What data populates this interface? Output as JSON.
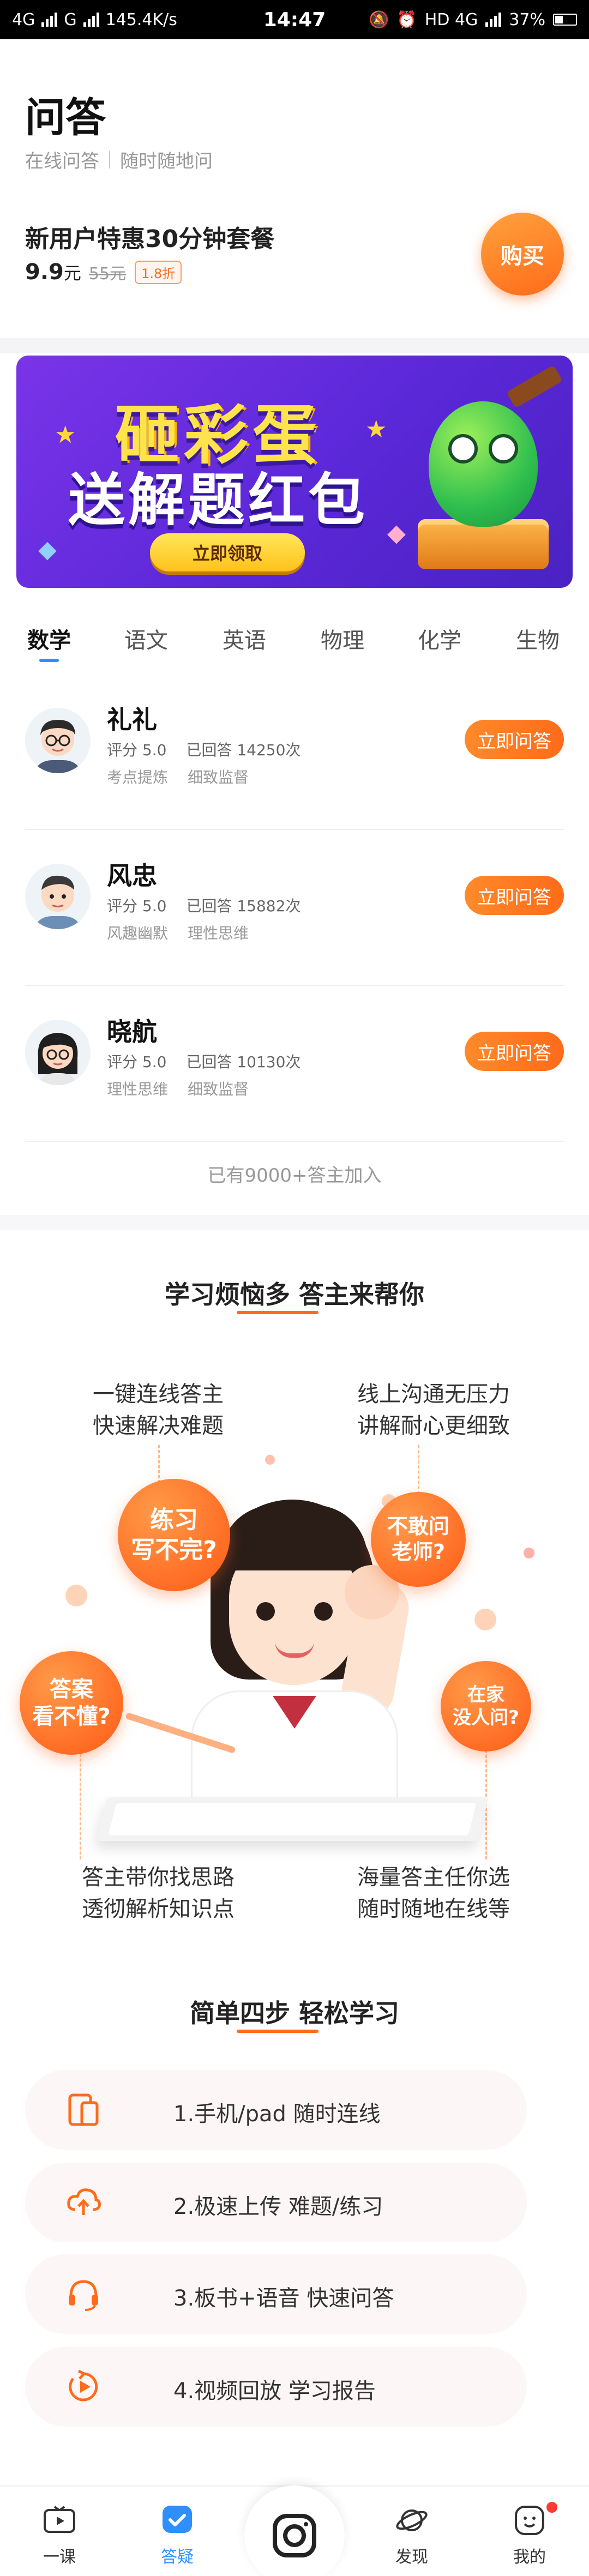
{
  "status_bar": {
    "network_left": "4G",
    "network_mid": "G",
    "speed": "145.4K/s",
    "time": "14:47",
    "network_right": "HD 4G",
    "battery": "37%"
  },
  "header": {
    "title": "问答",
    "subtitle_parts": [
      "在线问答",
      "随时随地问"
    ],
    "promo_title": "新用户特惠30分钟套餐",
    "price": "9.9",
    "price_unit": "元",
    "old_price": "55元",
    "discount": "1.8折",
    "buy_label": "购买"
  },
  "banner": {
    "line1": "砸彩蛋",
    "line2": "送解题红包",
    "button": "立即领取"
  },
  "tabs": [
    "数学",
    "语文",
    "英语",
    "物理",
    "化学",
    "生物"
  ],
  "active_tab": 0,
  "tutors": [
    {
      "name": "礼礼",
      "rating": "评分 5.0",
      "answered": "已回答 14250次",
      "tags": [
        "考点提炼",
        "细致监督"
      ],
      "ask_label": "立即问答",
      "avatar": "male-glasses-avatar"
    },
    {
      "name": "风忠",
      "rating": "评分 5.0",
      "answered": "已回答 15882次",
      "tags": [
        "风趣幽默",
        "理性思维"
      ],
      "ask_label": "立即问答",
      "avatar": "male-avatar"
    },
    {
      "name": "晓航",
      "rating": "评分 5.0",
      "answered": "已回答 10130次",
      "tags": [
        "理性思维",
        "细致监督"
      ],
      "ask_label": "立即问答",
      "avatar": "female-glasses-avatar"
    }
  ],
  "joined_text": "已有9000+答主加入",
  "section1": {
    "title": "学习烦恼多 答主来帮你",
    "top_left": [
      "一键连线答主",
      "快速解决难题"
    ],
    "top_right": [
      "线上沟通无压力",
      "讲解耐心更细致"
    ],
    "bottom_left": [
      "答主带你找思路",
      "透彻解析知识点"
    ],
    "bottom_right": [
      "海量答主任你选",
      "随时随地在线等"
    ],
    "bubbles": [
      {
        "lines": [
          "练习",
          "写不完?"
        ]
      },
      {
        "lines": [
          "不敢问",
          "老师?"
        ]
      },
      {
        "lines": [
          "答案",
          "看不懂?"
        ]
      },
      {
        "lines": [
          "在家",
          "没人问?"
        ]
      }
    ]
  },
  "section2": {
    "title": "简单四步 轻松学习",
    "steps": [
      {
        "text": "1.手机/pad 随时连线",
        "icon": "device-icon"
      },
      {
        "text": "2.极速上传 难题/练习",
        "icon": "cloud-upload-icon"
      },
      {
        "text": "3.板书+语音 快速问答",
        "icon": "headset-icon"
      },
      {
        "text": "4.视频回放 学习报告",
        "icon": "video-replay-icon"
      }
    ]
  },
  "bottom_nav": {
    "items": [
      {
        "label": "一课",
        "icon": "play-tv-icon"
      },
      {
        "label": "答疑",
        "icon": "check-chat-icon"
      },
      {
        "label": "发现",
        "icon": "planet-icon"
      },
      {
        "label": "我的",
        "icon": "face-icon"
      }
    ],
    "active": 1,
    "center_icon": "camera-icon"
  },
  "colors": {
    "accent": "#ff6b1a",
    "tab_active": "#2f8fff",
    "banner": "#5b28d8"
  }
}
